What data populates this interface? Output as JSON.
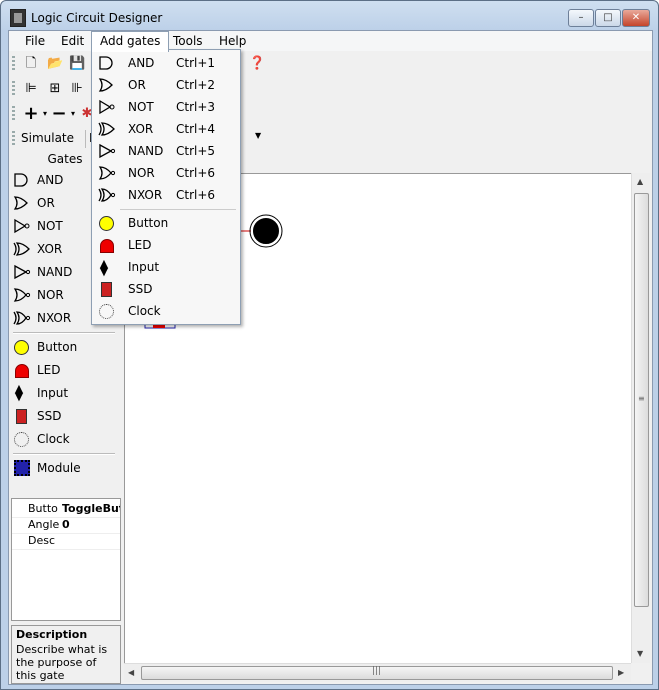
{
  "window": {
    "title": "Logic Circuit Designer",
    "min": "–",
    "max": "□",
    "close": "✕"
  },
  "menu": {
    "file": "File",
    "edit": "Edit",
    "add_gates": "Add gates",
    "tools": "Tools",
    "help": "Help"
  },
  "toolbar": {
    "simulate": "Simulate",
    "partial_label": "N"
  },
  "sidebar": {
    "heading": "Gates",
    "gates": [
      {
        "label": "AND",
        "icon": "and-gate-icon"
      },
      {
        "label": "OR",
        "icon": "or-gate-icon"
      },
      {
        "label": "NOT",
        "icon": "not-gate-icon"
      },
      {
        "label": "XOR",
        "icon": "xor-gate-icon"
      },
      {
        "label": "NAND",
        "icon": "nand-gate-icon"
      },
      {
        "label": "NOR",
        "icon": "nor-gate-icon"
      },
      {
        "label": "NXOR",
        "icon": "nxor-gate-icon"
      }
    ],
    "io": [
      {
        "label": "Button",
        "icon": "button-icon"
      },
      {
        "label": "LED",
        "icon": "led-icon"
      },
      {
        "label": "Input",
        "icon": "input-icon"
      },
      {
        "label": "SSD",
        "icon": "ssd-icon"
      },
      {
        "label": "Clock",
        "icon": "clock-icon"
      }
    ],
    "module": {
      "label": "Module",
      "icon": "module-icon"
    }
  },
  "properties": [
    {
      "name": "Butto",
      "value": "ToggleBut"
    },
    {
      "name": "Angle",
      "value": "0"
    },
    {
      "name": "Desc",
      "value": ""
    }
  ],
  "description": {
    "title": "Description",
    "text": "Describe what is the purpose of this gate"
  },
  "dropdown": {
    "gates": [
      {
        "label": "AND",
        "shortcut": "Ctrl+1"
      },
      {
        "label": "OR",
        "shortcut": "Ctrl+2"
      },
      {
        "label": "NOT",
        "shortcut": "Ctrl+3"
      },
      {
        "label": "XOR",
        "shortcut": "Ctrl+4"
      },
      {
        "label": "NAND",
        "shortcut": "Ctrl+5"
      },
      {
        "label": "NOR",
        "shortcut": "Ctrl+6"
      },
      {
        "label": "NXOR",
        "shortcut": "Ctrl+6"
      }
    ],
    "io": [
      {
        "label": "Button"
      },
      {
        "label": "LED"
      },
      {
        "label": "Input"
      },
      {
        "label": "SSD"
      },
      {
        "label": "Clock"
      }
    ]
  },
  "colors": {
    "button": "#ffff00",
    "led": "#e00000",
    "canvas_node": "#000000"
  }
}
